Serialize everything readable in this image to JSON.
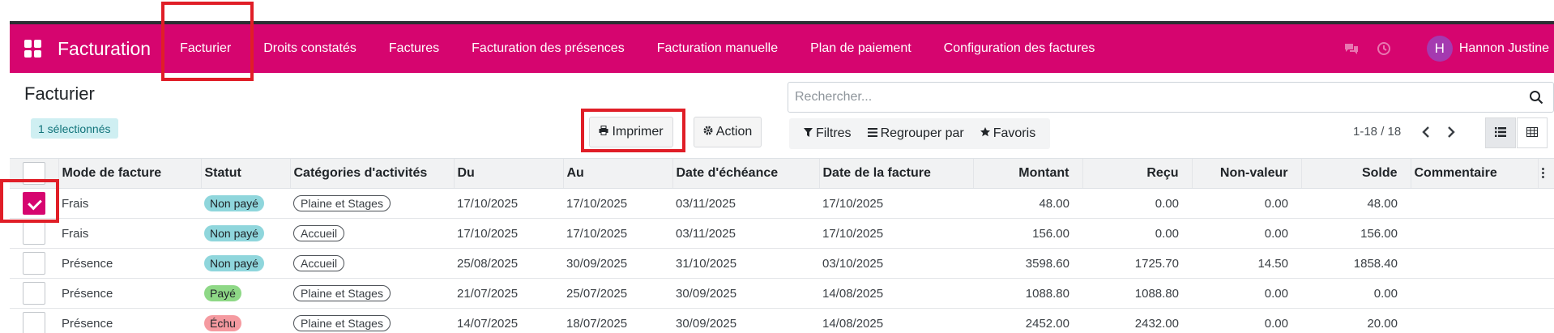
{
  "navbar": {
    "brand": "Facturation",
    "menu": [
      {
        "label": "Facturier",
        "name": "nav-facturier"
      },
      {
        "label": "Droits constatés",
        "name": "nav-droits-constates"
      },
      {
        "label": "Factures",
        "name": "nav-factures"
      },
      {
        "label": "Facturation des présences",
        "name": "nav-facturation-presences"
      },
      {
        "label": "Facturation manuelle",
        "name": "nav-facturation-manuelle"
      },
      {
        "label": "Plan de paiement",
        "name": "nav-plan-paiement"
      },
      {
        "label": "Configuration des factures",
        "name": "nav-configuration-factures"
      }
    ],
    "user_initial": "H",
    "user_name": "Hannon Justine",
    "brand_color": "#d6056f"
  },
  "page": {
    "title": "Facturier",
    "selected_badge": "1 sélectionnés"
  },
  "toolbar": {
    "print_label": "Imprimer",
    "action_label": "Action"
  },
  "search": {
    "placeholder": "Rechercher...",
    "value": ""
  },
  "filters": {
    "filters_label": "Filtres",
    "group_label": "Regrouper par",
    "favorites_label": "Favoris"
  },
  "pager": {
    "text": "1-18 / 18"
  },
  "table": {
    "headers": {
      "mode": "Mode de facture",
      "statut": "Statut",
      "categories": "Catégories d'activités",
      "du": "Du",
      "au": "Au",
      "echeance": "Date d'échéance",
      "date_facture": "Date de la facture",
      "montant": "Montant",
      "recu": "Reçu",
      "non_valeur": "Non-valeur",
      "solde": "Solde",
      "commentaire": "Commentaire"
    },
    "rows": [
      {
        "checked": true,
        "mode": "Frais",
        "statut": "Non payé",
        "statut_color": "#8fd6dc",
        "categorie": "Plaine et Stages",
        "du": "17/10/2025",
        "au": "17/10/2025",
        "echeance": "03/11/2025",
        "date_facture": "17/10/2025",
        "montant": "48.00",
        "recu": "0.00",
        "non_valeur": "0.00",
        "solde": "48.00",
        "commentaire": ""
      },
      {
        "checked": false,
        "mode": "Frais",
        "statut": "Non payé",
        "statut_color": "#8fd6dc",
        "categorie": "Accueil",
        "du": "17/10/2025",
        "au": "17/10/2025",
        "echeance": "03/11/2025",
        "date_facture": "17/10/2025",
        "montant": "156.00",
        "recu": "0.00",
        "non_valeur": "0.00",
        "solde": "156.00",
        "commentaire": ""
      },
      {
        "checked": false,
        "mode": "Présence",
        "statut": "Non payé",
        "statut_color": "#8fd6dc",
        "categorie": "Accueil",
        "du": "25/08/2025",
        "au": "30/09/2025",
        "echeance": "31/10/2025",
        "date_facture": "03/10/2025",
        "montant": "3598.60",
        "recu": "1725.70",
        "non_valeur": "14.50",
        "solde": "1858.40",
        "commentaire": ""
      },
      {
        "checked": false,
        "mode": "Présence",
        "statut": "Payé",
        "statut_color": "#8ed886",
        "categorie": "Plaine et Stages",
        "du": "21/07/2025",
        "au": "25/07/2025",
        "echeance": "30/09/2025",
        "date_facture": "14/08/2025",
        "montant": "1088.80",
        "recu": "1088.80",
        "non_valeur": "0.00",
        "solde": "0.00",
        "commentaire": ""
      },
      {
        "checked": false,
        "mode": "Présence",
        "statut": "Échu",
        "statut_color": "#f59aa0",
        "categorie": "Plaine et Stages",
        "du": "14/07/2025",
        "au": "18/07/2025",
        "echeance": "30/09/2025",
        "date_facture": "14/08/2025",
        "montant": "2452.00",
        "recu": "2432.00",
        "non_valeur": "0.00",
        "solde": "20.00",
        "commentaire": ""
      }
    ]
  }
}
